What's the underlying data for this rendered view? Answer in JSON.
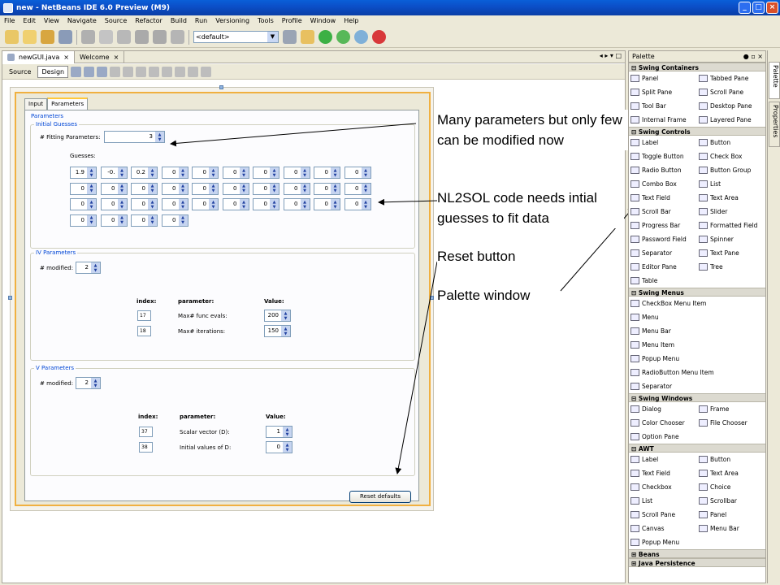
{
  "window": {
    "title": "new - NetBeans IDE 6.0 Preview (M9)"
  },
  "menu": [
    "File",
    "Edit",
    "View",
    "Navigate",
    "Source",
    "Refactor",
    "Build",
    "Run",
    "Versioning",
    "Tools",
    "Profile",
    "Window",
    "Help"
  ],
  "toolbar": {
    "config": "<default>"
  },
  "editor": {
    "doc_tabs": [
      "newGUI.java",
      "Welcome"
    ],
    "view_tabs": [
      "Source",
      "Design"
    ],
    "form_tabs": [
      "Input",
      "Parameters"
    ],
    "panel_title": "Parameters",
    "initial_guesses": {
      "title": "Initial Guesses",
      "fitting_label": "# Fitting Parameters:",
      "fitting_value": "3",
      "guesses_label": "Guesses:",
      "row1": [
        "1.9",
        "-0.",
        "0.2",
        "0",
        "0",
        "0",
        "0",
        "0",
        "0",
        "0"
      ],
      "row2": [
        "0",
        "0",
        "0",
        "0",
        "0",
        "0",
        "0",
        "0",
        "0",
        "0"
      ],
      "row3": [
        "0",
        "0",
        "0",
        "0",
        "0",
        "0",
        "0",
        "0",
        "0",
        "0"
      ],
      "row4": [
        "0",
        "0",
        "0",
        "0"
      ]
    },
    "iv_params": {
      "title": "IV Parameters",
      "modified_label": "# modified:",
      "modified_value": "2",
      "col_index": "index:",
      "col_param": "parameter:",
      "col_value": "Value:",
      "rows": [
        {
          "index": "17",
          "param": "Max# func evals:",
          "value": "200"
        },
        {
          "index": "18",
          "param": "Max# iterations:",
          "value": "150"
        }
      ]
    },
    "v_params": {
      "title": "V Parameters",
      "modified_label": "# modified:",
      "modified_value": "2",
      "col_index": "index:",
      "col_param": "parameter:",
      "col_value": "Value:",
      "rows": [
        {
          "index": "37",
          "param": "Scalar vector (D):",
          "value": "1"
        },
        {
          "index": "38",
          "param": "Initial values of D:",
          "value": "0"
        }
      ]
    },
    "reset_label": "Reset defaults"
  },
  "annotations": {
    "a1": "Many parameters but only few can be modified now",
    "a2": "NL2SOL code needs intial guesses to fit data",
    "a3": "Reset button",
    "a4": "Palette window"
  },
  "palette": {
    "title": "Palette",
    "side_tabs": [
      "Palette",
      "Properties"
    ],
    "swing_containers": {
      "title": "Swing Containers",
      "items": [
        "Panel",
        "Tabbed Pane",
        "Split Pane",
        "Scroll Pane",
        "Tool Bar",
        "Desktop Pane",
        "Internal Frame",
        "Layered Pane"
      ]
    },
    "swing_controls": {
      "title": "Swing Controls",
      "items": [
        "Label",
        "Button",
        "Toggle Button",
        "Check Box",
        "Radio Button",
        "Button Group",
        "Combo Box",
        "List",
        "Text Field",
        "Text Area",
        "Scroll Bar",
        "Slider",
        "Progress Bar",
        "Formatted Field",
        "Password Field",
        "Spinner",
        "Separator",
        "Text Pane",
        "Editor Pane",
        "Tree",
        "Table"
      ]
    },
    "swing_menus": {
      "title": "Swing Menus",
      "items": [
        "CheckBox Menu Item",
        "Menu",
        "Menu Bar",
        "Menu Item",
        "Popup Menu",
        "RadioButton Menu Item",
        "Separator"
      ]
    },
    "swing_windows": {
      "title": "Swing Windows",
      "items": [
        "Dialog",
        "Frame",
        "Color Chooser",
        "File Chooser",
        "Option Pane"
      ]
    },
    "awt": {
      "title": "AWT",
      "items": [
        "Label",
        "Button",
        "Text Field",
        "Text Area",
        "Checkbox",
        "Choice",
        "List",
        "Scrollbar",
        "Scroll Pane",
        "Panel",
        "Canvas",
        "Menu Bar",
        "Popup Menu"
      ]
    },
    "beans": {
      "title": "Beans"
    },
    "java_persistence": {
      "title": "Java Persistence"
    }
  }
}
